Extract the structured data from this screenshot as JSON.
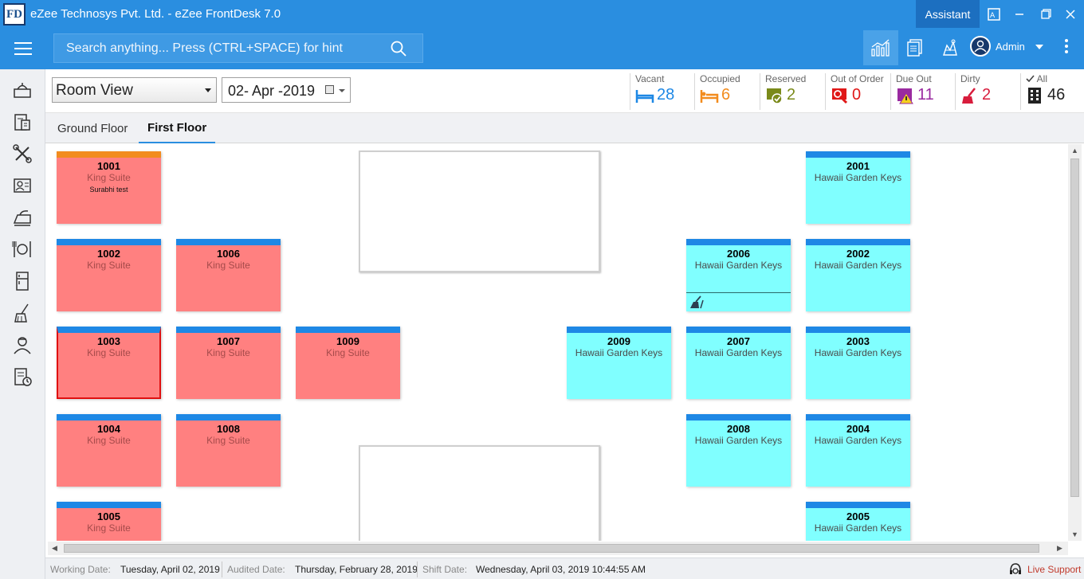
{
  "window": {
    "logo": "FD",
    "title": "eZee Technosys Pvt. Ltd. - eZee FrontDesk 7.0",
    "assistant_label": "Assistant"
  },
  "topbar": {
    "search_placeholder": "Search anything... Press (CTRL+SPACE) for hint",
    "user_name": "Admin"
  },
  "toolbar": {
    "view_select": "Room View",
    "date": "02- Apr -2019",
    "stats": {
      "vacant": {
        "label": "Vacant",
        "value": "28",
        "color": "#1e88e5"
      },
      "occupied": {
        "label": "Occupied",
        "value": "6",
        "color": "#f28c1e"
      },
      "reserved": {
        "label": "Reserved",
        "value": "2",
        "color": "#7a8a1a"
      },
      "out_of_order": {
        "label": "Out of Order",
        "value": "0",
        "color": "#e01818"
      },
      "due_out": {
        "label": "Due Out",
        "value": "11",
        "color": "#9a2aa0"
      },
      "dirty": {
        "label": "Dirty",
        "value": "2",
        "color": "#d81c3c"
      },
      "all": {
        "label": "All",
        "value": "46",
        "color": "#222222"
      }
    }
  },
  "tabs": [
    {
      "label": "Ground Floor"
    },
    {
      "label": "First Floor"
    }
  ],
  "rooms": [
    {
      "no": "1001",
      "type": "King Suite",
      "guest": "Surabhi test"
    },
    {
      "no": "1002",
      "type": "King Suite"
    },
    {
      "no": "1003",
      "type": "King Suite"
    },
    {
      "no": "1004",
      "type": "King Suite"
    },
    {
      "no": "1005",
      "type": "King Suite"
    },
    {
      "no": "1006",
      "type": "King Suite"
    },
    {
      "no": "1007",
      "type": "King Suite"
    },
    {
      "no": "1008",
      "type": "King Suite"
    },
    {
      "no": "1009",
      "type": "King Suite"
    },
    {
      "no": "2009",
      "type": "Hawaii Garden Keys"
    },
    {
      "no": "2006",
      "type": "Hawaii Garden Keys"
    },
    {
      "no": "2007",
      "type": "Hawaii Garden Keys"
    },
    {
      "no": "2008",
      "type": "Hawaii Garden Keys"
    },
    {
      "no": "2001",
      "type": "Hawaii Garden Keys"
    },
    {
      "no": "2002",
      "type": "Hawaii Garden Keys"
    },
    {
      "no": "2003",
      "type": "Hawaii Garden Keys"
    },
    {
      "no": "2004",
      "type": "Hawaii Garden Keys"
    },
    {
      "no": "2005",
      "type": "Hawaii Garden Keys"
    }
  ],
  "statusbar": {
    "working_date_label": "Working Date:",
    "working_date": "Tuesday, April 02, 2019",
    "audited_date_label": "Audited Date:",
    "audited_date": "Thursday, February 28, 2019",
    "shift_date_label": "Shift Date:",
    "shift_date": "Wednesday, April 03, 2019 10:44:55 AM",
    "live_support": "Live Support"
  }
}
